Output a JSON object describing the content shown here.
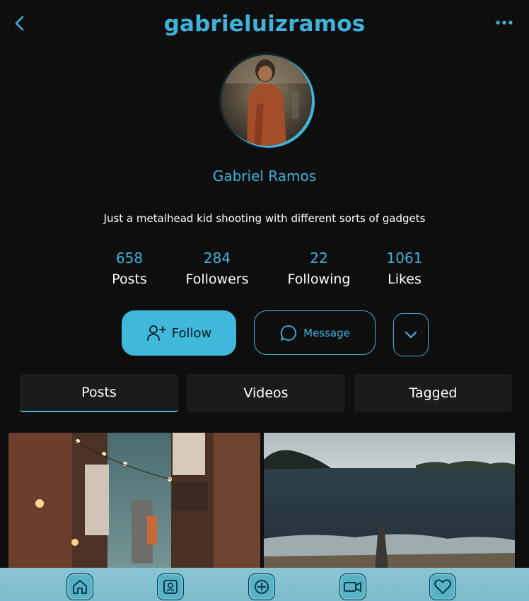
{
  "header": {
    "username": "gabrieluizramos"
  },
  "profile": {
    "display_name": "Gabriel Ramos",
    "bio": "Just a metalhead kid shooting with different sorts of gadgets"
  },
  "stats": [
    {
      "value": "658",
      "label": "Posts"
    },
    {
      "value": "284",
      "label": "Followers"
    },
    {
      "value": "22",
      "label": "Following"
    },
    {
      "value": "1061",
      "label": "Likes"
    }
  ],
  "actions": {
    "follow_label": "Follow",
    "message_label": "Message"
  },
  "tabs": [
    {
      "label": "Posts",
      "active": true
    },
    {
      "label": "Videos",
      "active": false
    },
    {
      "label": "Tagged",
      "active": false
    }
  ],
  "icons": {
    "back": "chevron-left-icon",
    "more": "ellipsis-icon",
    "follow": "user-plus-icon",
    "message": "chat-bubble-icon",
    "expand": "chevron-down-icon",
    "nav": [
      "home-icon",
      "profile-icon",
      "add-icon",
      "video-icon",
      "heart-icon"
    ]
  },
  "colors": {
    "accent": "#3fb2d9",
    "background": "#0e0e0f",
    "tab_background": "#1b1b1d",
    "follow_button": "#3fb8dc",
    "bottom_nav": "#84c1cf"
  }
}
